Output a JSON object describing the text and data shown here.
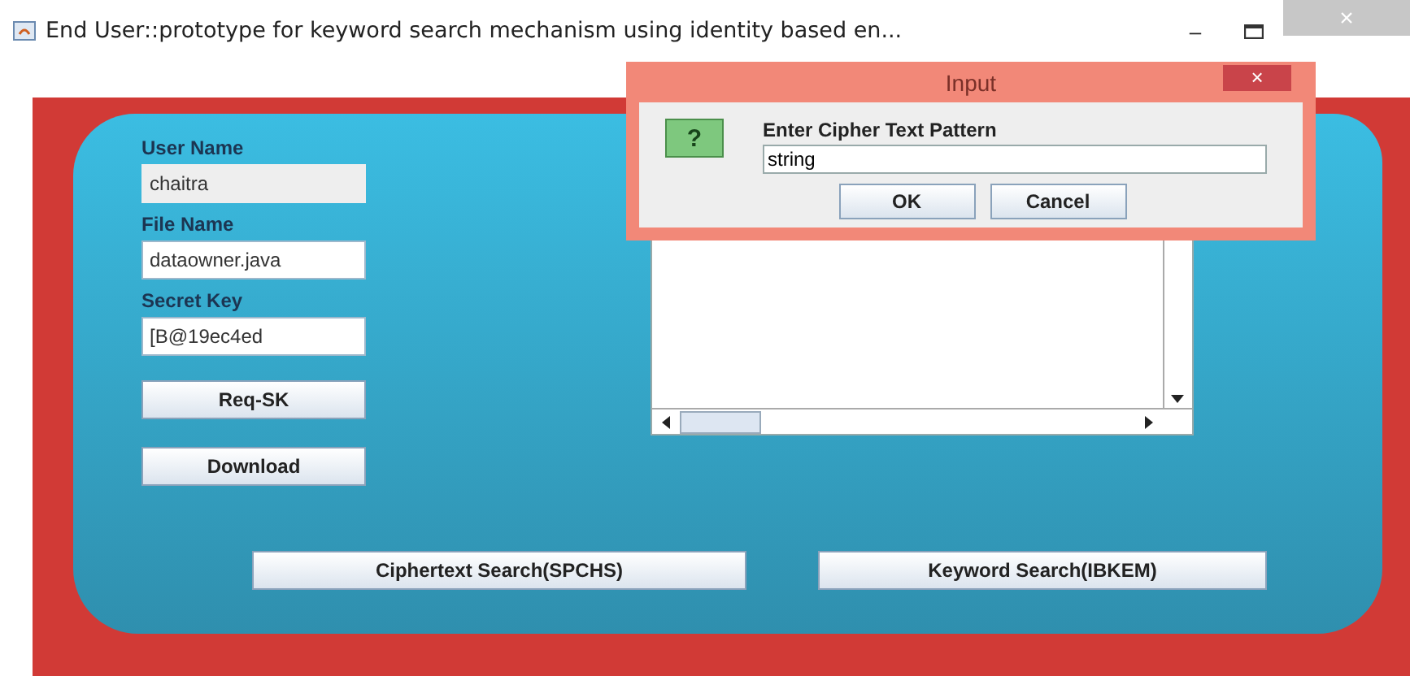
{
  "window": {
    "title": "End User::prototype for keyword search mechanism using identity based en...",
    "controls": [
      "–",
      "×"
    ]
  },
  "form": {
    "fields": [
      {
        "label": "User Name",
        "value": "chaitra",
        "disabled": true
      },
      {
        "label": "File Name",
        "value": "dataowner.java",
        "disabled": false
      },
      {
        "label": "Secret Key",
        "value": "[B@19ec4ed",
        "disabled": false
      }
    ],
    "buttons": [
      "Req-SK",
      "Download"
    ]
  },
  "bottom_buttons": [
    "Ciphertext Search(SPCHS)",
    "Keyword Search(IBKEM)"
  ],
  "dialog": {
    "title": "Input",
    "close": "×",
    "icon": "?",
    "prompt": "Enter Cipher Text Pattern",
    "value": "string",
    "buttons": [
      "OK",
      "Cancel"
    ]
  }
}
